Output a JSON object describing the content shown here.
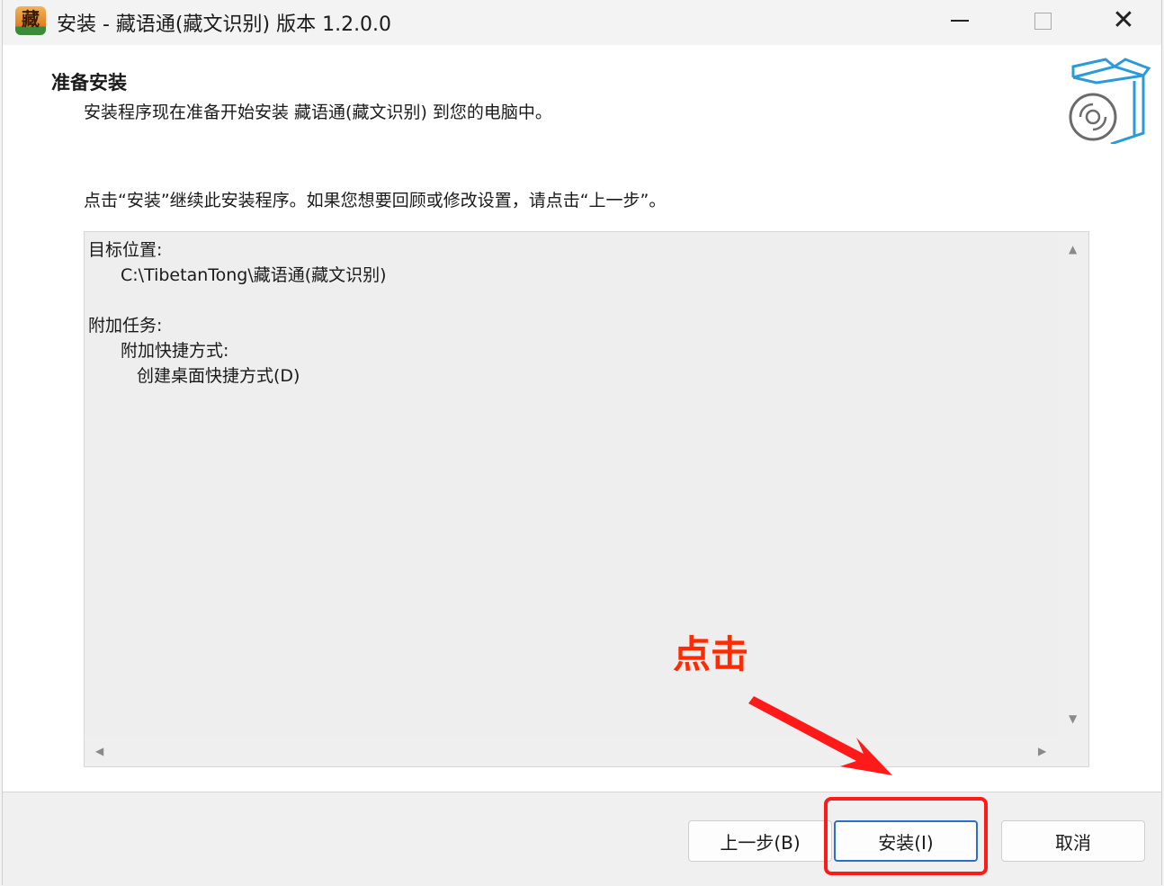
{
  "window": {
    "title": "安装 - 藏语通(藏文识别) 版本 1.2.0.0",
    "app_icon_glyph": "藏"
  },
  "header": {
    "title": "准备安装",
    "subtitle": "安装程序现在准备开始安装 藏语通(藏文识别) 到您的电脑中。"
  },
  "body": {
    "instruction": "点击“安装”继续此安装程序。如果您想要回顾或修改设置，请点击“上一步”。",
    "memo": {
      "dest_label": "目标位置:",
      "dest_path": "C:\\TibetanTong\\藏语通(藏文识别)",
      "tasks_label": "附加任务:",
      "shortcuts_label": "附加快捷方式:",
      "desktop_shortcut": "创建桌面快捷方式(D)"
    }
  },
  "footer": {
    "back_label": "上一步(B)",
    "install_label": "安装(I)",
    "cancel_label": "取消"
  },
  "annotation": {
    "text": "点击",
    "color": "#ff2a00"
  },
  "icons": {
    "minimize": "minimize-icon",
    "maximize": "maximize-icon",
    "close": "close-icon",
    "setup": "setup-box-disc-icon"
  }
}
